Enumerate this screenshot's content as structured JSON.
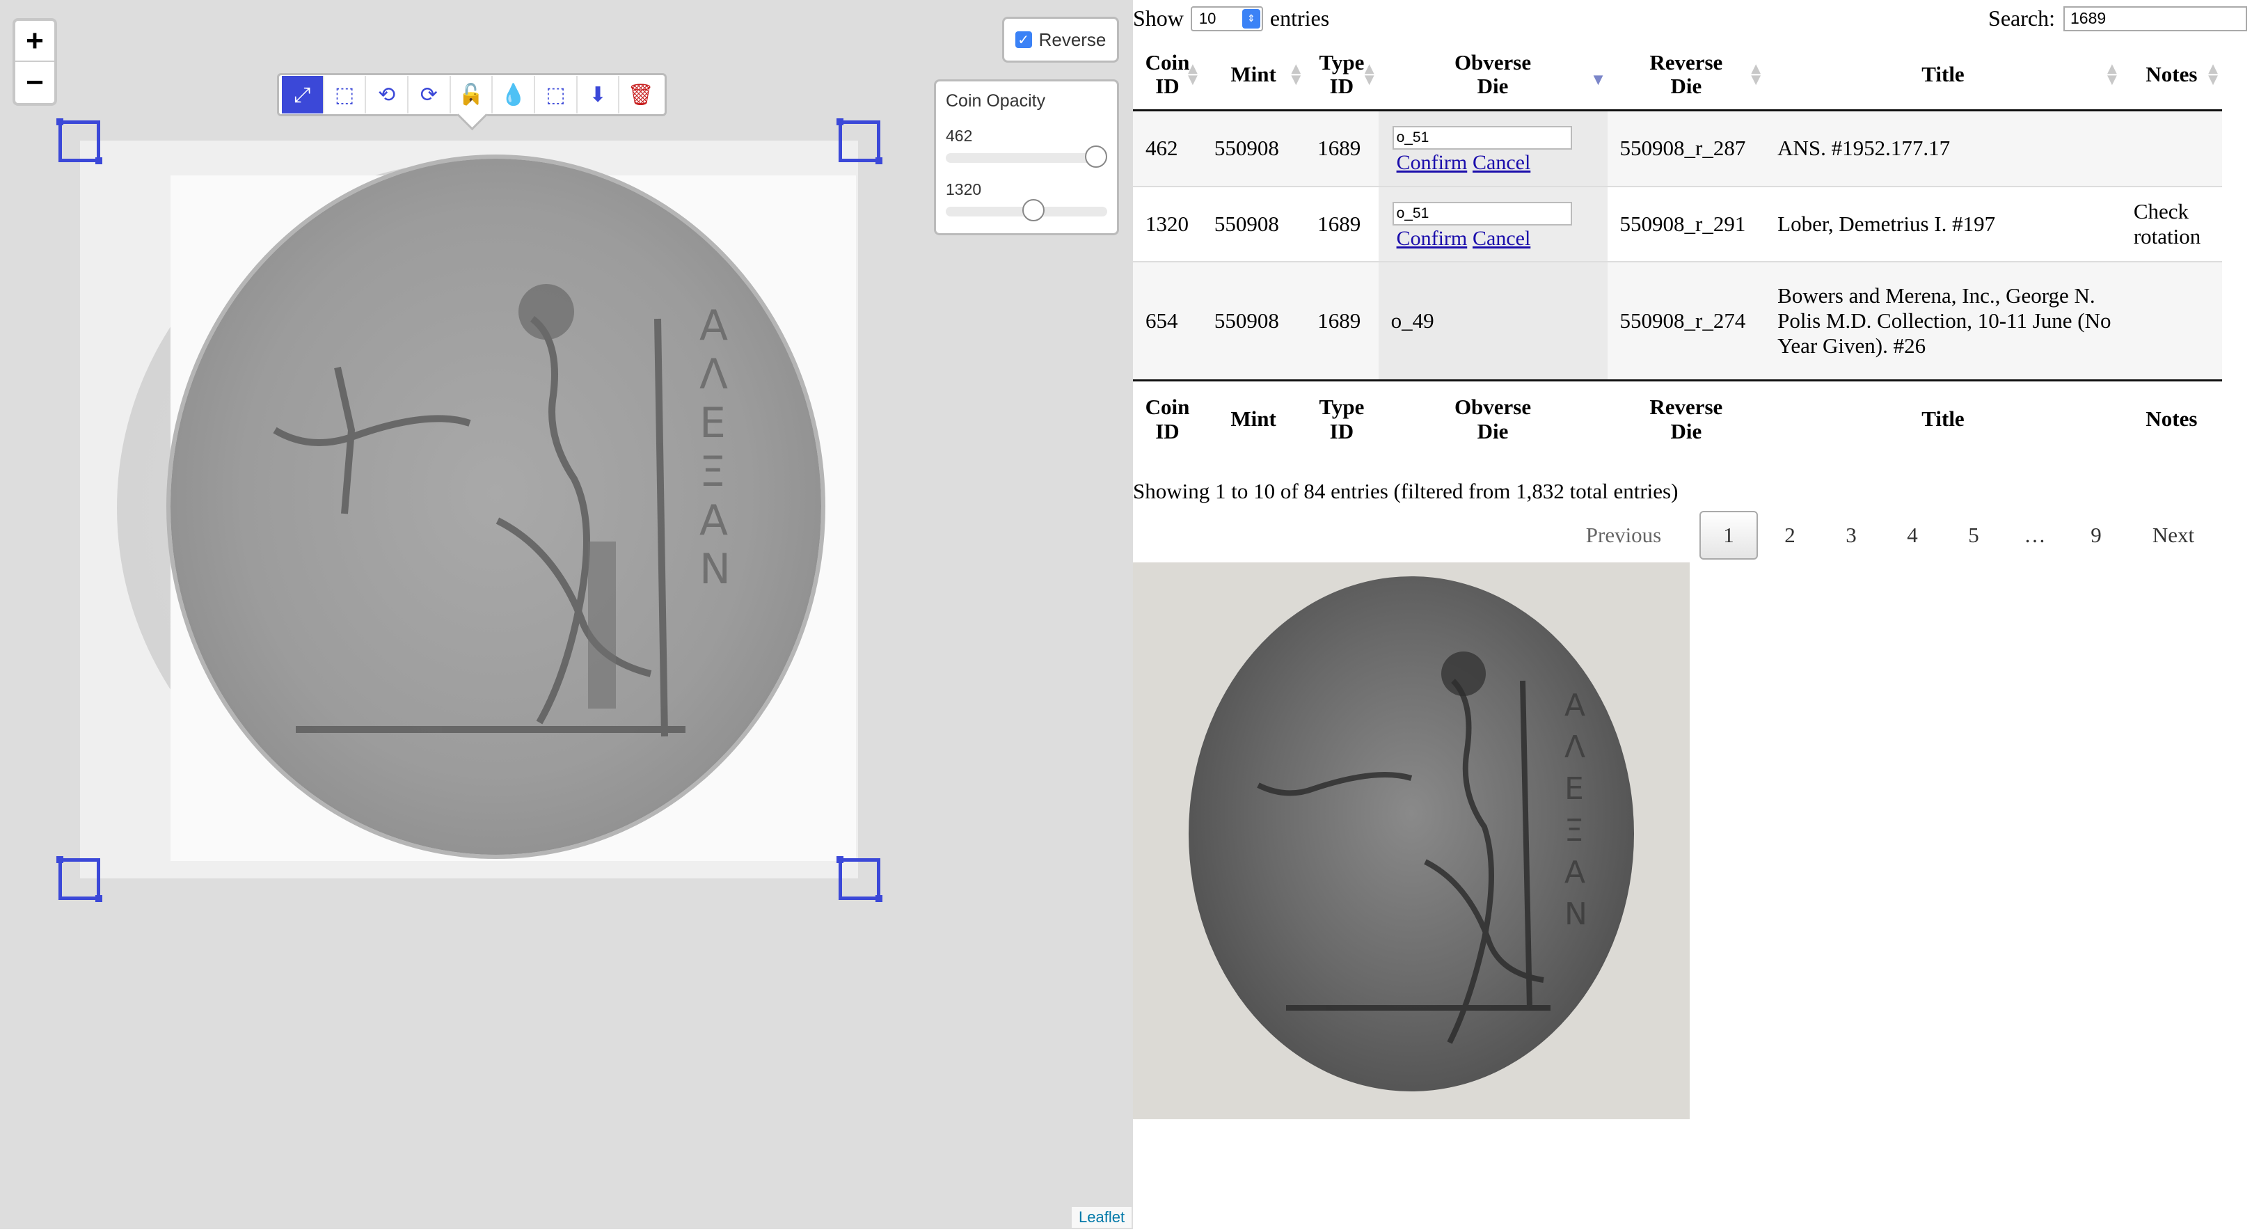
{
  "map": {
    "zoom_in": "+",
    "zoom_out": "−",
    "reverse_label": "Reverse",
    "opacity": {
      "title": "Coin Opacity",
      "sliders": [
        {
          "label": "462",
          "value": 1.0
        },
        {
          "label": "1320",
          "value": 0.55
        }
      ]
    },
    "toolbar": [
      {
        "name": "scale-icon",
        "glyph": "⤢",
        "active": true
      },
      {
        "name": "distort-icon",
        "glyph": "⬚",
        "active": false
      },
      {
        "name": "rotate-icon",
        "glyph": "⟲",
        "active": false
      },
      {
        "name": "free-rotate-icon",
        "glyph": "⟳",
        "active": false
      },
      {
        "name": "lock-icon",
        "glyph": "🔓",
        "active": false
      },
      {
        "name": "opacity-icon",
        "glyph": "💧",
        "active": false
      },
      {
        "name": "border-icon",
        "glyph": "⬚",
        "active": false
      },
      {
        "name": "export-icon",
        "glyph": "⬇",
        "active": false
      },
      {
        "name": "delete-icon",
        "glyph": "🗑",
        "active": false
      }
    ],
    "attribution": "Leaflet"
  },
  "table": {
    "show_label": "Show",
    "entries_label": "entries",
    "page_size": "10",
    "search_label": "Search:",
    "search_value": "1689",
    "columns": [
      "Coin ID",
      "Mint",
      "Type ID",
      "Obverse Die",
      "Reverse Die",
      "Title",
      "Notes"
    ],
    "rows": [
      {
        "coin_id": "462",
        "mint": "550908",
        "type_id": "1689",
        "obverse": "o_51",
        "obverse_editing": true,
        "reverse": "550908_r_287",
        "title": "ANS. #1952.177.17",
        "notes": ""
      },
      {
        "coin_id": "1320",
        "mint": "550908",
        "type_id": "1689",
        "obverse": "o_51",
        "obverse_editing": true,
        "reverse": "550908_r_291",
        "title": "Lober, Demetrius I. #197",
        "notes": "Check rotation"
      },
      {
        "coin_id": "654",
        "mint": "550908",
        "type_id": "1689",
        "obverse": "o_49",
        "obverse_editing": false,
        "reverse": "550908_r_274",
        "title": "Bowers and Merena, Inc., George N. Polis M.D. Collection, 10-11 June (No Year Given). #26",
        "notes": ""
      }
    ],
    "confirm_label": "Confirm",
    "cancel_label": "Cancel",
    "info": "Showing 1 to 10 of 84 entries (filtered from 1,832 total entries)",
    "pagination": {
      "previous": "Previous",
      "pages": [
        "1",
        "2",
        "3",
        "4",
        "5",
        "…",
        "9"
      ],
      "current": "1",
      "next": "Next"
    }
  }
}
